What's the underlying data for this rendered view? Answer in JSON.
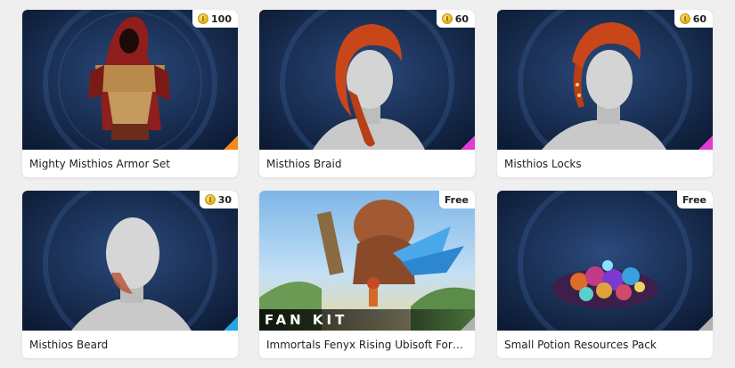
{
  "colors": {
    "background": "#efefef",
    "card": "#ffffff",
    "corner_orange": "#f28a1d",
    "corner_pink": "#e23bd0",
    "corner_blue": "#22a7e0",
    "corner_gray": "#b0b0b0"
  },
  "items": [
    {
      "title": "Mighty Misthios Armor Set",
      "price": "100",
      "price_icon": "coin-icon",
      "corner": "orange"
    },
    {
      "title": "Misthios Braid",
      "price": "60",
      "price_icon": "coin-icon",
      "corner": "pink"
    },
    {
      "title": "Misthios Locks",
      "price": "60",
      "price_icon": "coin-icon",
      "corner": "pink"
    },
    {
      "title": "Misthios Beard",
      "price": "30",
      "price_icon": "coin-icon",
      "corner": "blue"
    },
    {
      "title": "Immortals Fenyx Rising Ubisoft Forwa...",
      "price": "Free",
      "overlay": "FAN KIT",
      "corner": "gray"
    },
    {
      "title": "Small Potion Resources Pack",
      "price": "Free",
      "corner": "gray"
    }
  ]
}
